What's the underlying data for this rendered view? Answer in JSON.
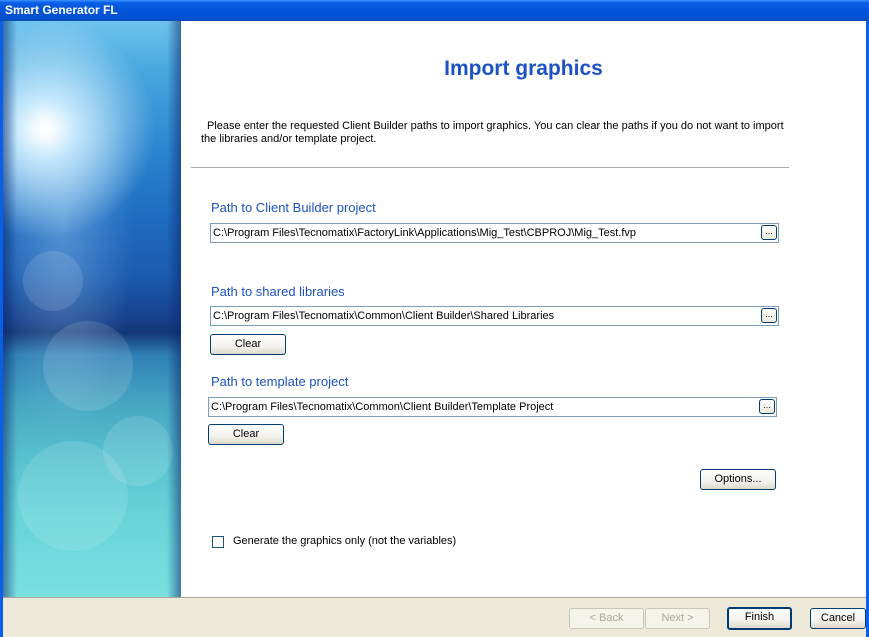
{
  "window": {
    "title": "Smart Generator FL"
  },
  "page": {
    "heading": "Import graphics",
    "intro": "Please enter the requested Client Builder paths to import graphics. You can clear the paths if you do not want to import the libraries and/or template project."
  },
  "sections": {
    "project": {
      "label": "Path to Client Builder project",
      "value": "C:\\Program Files\\Tecnomatix\\FactoryLink\\Applications\\Mig_Test\\CBPROJ\\Mig_Test.fvp",
      "browse_label": "..."
    },
    "libraries": {
      "label": "Path to shared libraries",
      "value": "C:\\Program Files\\Tecnomatix\\Common\\Client Builder\\Shared Libraries",
      "browse_label": "...",
      "clear_label": "Clear"
    },
    "template": {
      "label": "Path to template project",
      "value": "C:\\Program Files\\Tecnomatix\\Common\\Client Builder\\Template Project",
      "browse_label": "...",
      "clear_label": "Clear"
    }
  },
  "options_label": "Options...",
  "checkbox": {
    "label": "Generate the graphics only (not the variables)",
    "checked": false
  },
  "footer": {
    "back_label": "< Back",
    "next_label": "Next >",
    "finish_label": "Finish",
    "cancel_label": "Cancel"
  },
  "colors": {
    "accent": "#1d52c4",
    "titlebar": "#0454d8"
  }
}
